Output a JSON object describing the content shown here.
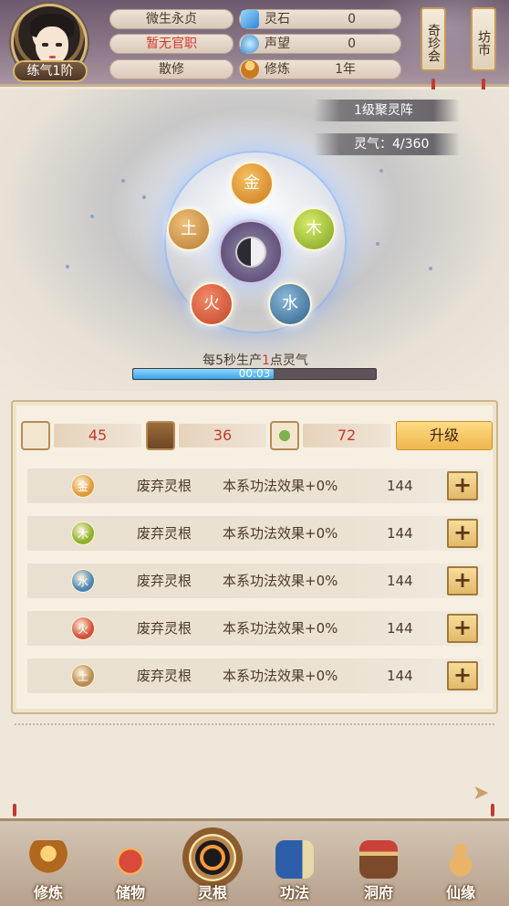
{
  "header": {
    "player_name": "微生永贞",
    "official_title": "暂无官职",
    "sect": "散修",
    "realm": "练气1阶",
    "resources": [
      {
        "label": "灵石",
        "value": "0",
        "icon": "spirit-stone-icon",
        "color": "#4aa3e8"
      },
      {
        "label": "声望",
        "value": "0",
        "icon": "prestige-icon",
        "color": "#5ab0e6"
      },
      {
        "label": "修炼",
        "value": "1年",
        "icon": "meditation-icon",
        "color": "#e0a040"
      }
    ],
    "side_tabs": [
      "奇珍会",
      "坊市"
    ]
  },
  "formation": {
    "name": "1级聚灵阵",
    "qi_label": "灵气：4/360",
    "elements": {
      "gold": "金",
      "wood": "木",
      "water": "水",
      "fire": "火",
      "earth": "土"
    },
    "production": {
      "prefix": "每5秒生产",
      "amount": "1",
      "suffix": "点灵气"
    },
    "timer": "00:03",
    "progress": 0.58
  },
  "materials": [
    {
      "icon": "scroll-icon",
      "value": "45"
    },
    {
      "icon": "book-icon",
      "value": "36"
    },
    {
      "icon": "herb-icon",
      "value": "72"
    }
  ],
  "upgrade_label": "升级",
  "roots": [
    {
      "element": "金",
      "color": "#e09a3a",
      "name": "废弃灵根",
      "effect": "本系功法效果+0%",
      "cost": "144",
      "action": "+"
    },
    {
      "element": "木",
      "color": "#8fb12a",
      "name": "废弃灵根",
      "effect": "本系功法效果+0%",
      "cost": "144",
      "action": "+"
    },
    {
      "element": "水",
      "color": "#4c86b2",
      "name": "废弃灵根",
      "effect": "本系功法效果+0%",
      "cost": "144",
      "action": "+"
    },
    {
      "element": "火",
      "color": "#d2503a",
      "name": "废弃灵根",
      "effect": "本系功法效果+0%",
      "cost": "144",
      "action": "+"
    },
    {
      "element": "土",
      "color": "#b98b4e",
      "name": "废弃灵根",
      "effect": "本系功法效果+0%",
      "cost": "144",
      "action": "+"
    }
  ],
  "nav": [
    {
      "label": "修炼",
      "icon": "cultivate-icon"
    },
    {
      "label": "储物",
      "icon": "storage-bag-icon"
    },
    {
      "label": "灵根",
      "icon": "spirit-root-icon",
      "active": true
    },
    {
      "label": "功法",
      "icon": "technique-book-icon"
    },
    {
      "label": "洞府",
      "icon": "cave-house-icon"
    },
    {
      "label": "仙缘",
      "icon": "fortune-gourd-icon"
    }
  ]
}
